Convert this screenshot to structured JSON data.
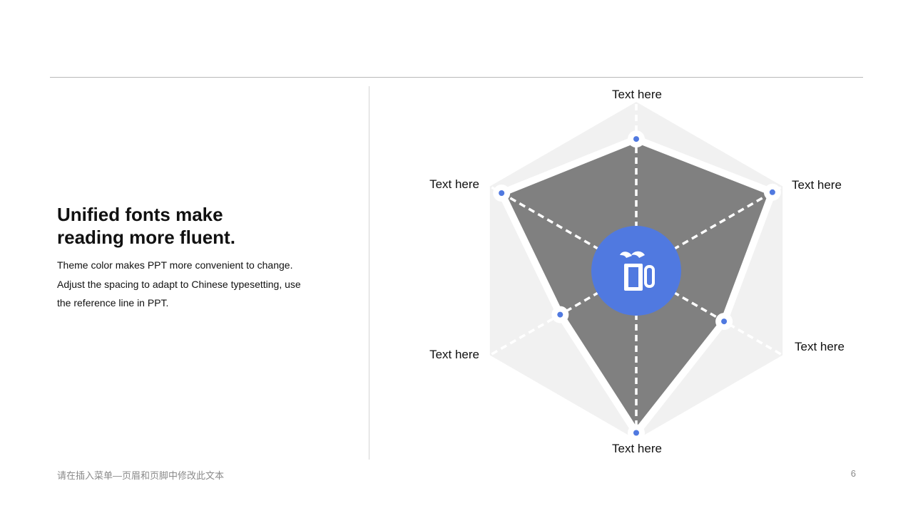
{
  "headline": {
    "line1": "Unified fonts make",
    "line2": "reading more fluent."
  },
  "body": {
    "line1": "Theme color makes PPT more convenient to change.",
    "line2": "Adjust the spacing to adapt to Chinese typesetting, use",
    "line3": "the reference line in PPT."
  },
  "footer": {
    "text": "请在插入菜单—页眉和页脚中修改此文本",
    "page_number": "6"
  },
  "colors": {
    "accent": "#5079e0",
    "fill": "#808080",
    "background_hexagon": "#f1f1f1"
  },
  "center_icon": "mug-icon",
  "chart_data": {
    "type": "radar",
    "max": 1,
    "axes": [
      {
        "label": "Text here",
        "value": 0.78
      },
      {
        "label": "Text here",
        "value": 0.93
      },
      {
        "label": "Text here",
        "value": 0.6
      },
      {
        "label": "Text here",
        "value": 0.96
      },
      {
        "label": "Text here",
        "value": 0.52
      },
      {
        "label": "Text here",
        "value": 0.92
      }
    ]
  }
}
